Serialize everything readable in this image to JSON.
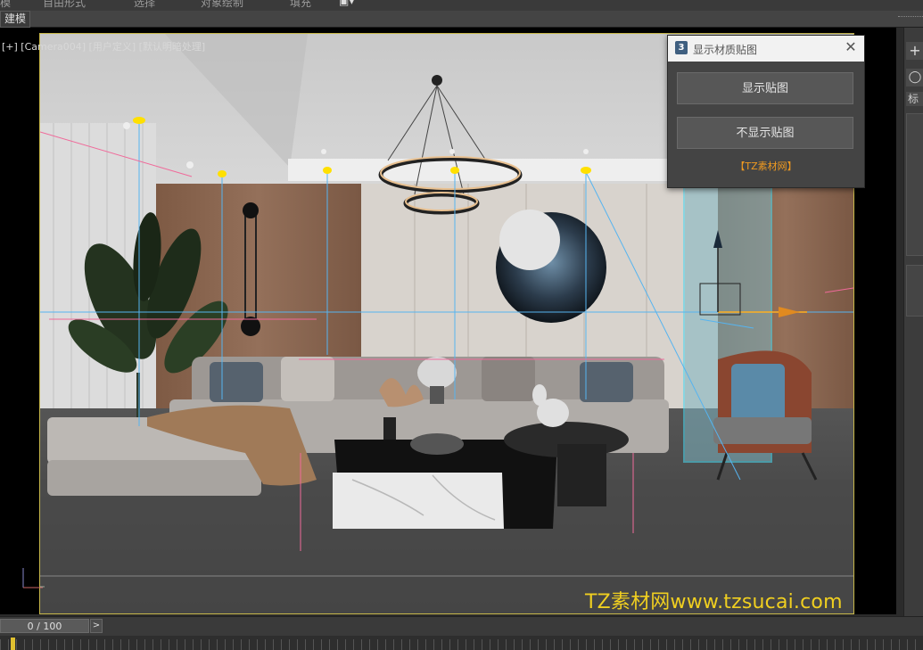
{
  "menu": {
    "tabs": [
      "模",
      "自由形式",
      "选择",
      "对象绘制",
      "填充"
    ],
    "ribbon_label": "建模"
  },
  "viewport": {
    "label": "[+] [Camera004] [用户定义] [默认明暗处理]",
    "watermark": "TZ素材网www.tzsucai.com"
  },
  "dialog": {
    "app_icon": "3",
    "title": "显示材质贴图",
    "close": "✕",
    "show_button": "显示贴图",
    "hide_button": "不显示贴图",
    "link": "【TZ素材网】"
  },
  "command_panel": {
    "create_symbol": "+",
    "tab_label": "标"
  },
  "timeline": {
    "frame_display": "0 / 100",
    "next_symbol": ">"
  },
  "colors": {
    "viewport_border": "#c8b84a",
    "watermark": "#f0cf20",
    "dialog_link": "#f09a20"
  }
}
